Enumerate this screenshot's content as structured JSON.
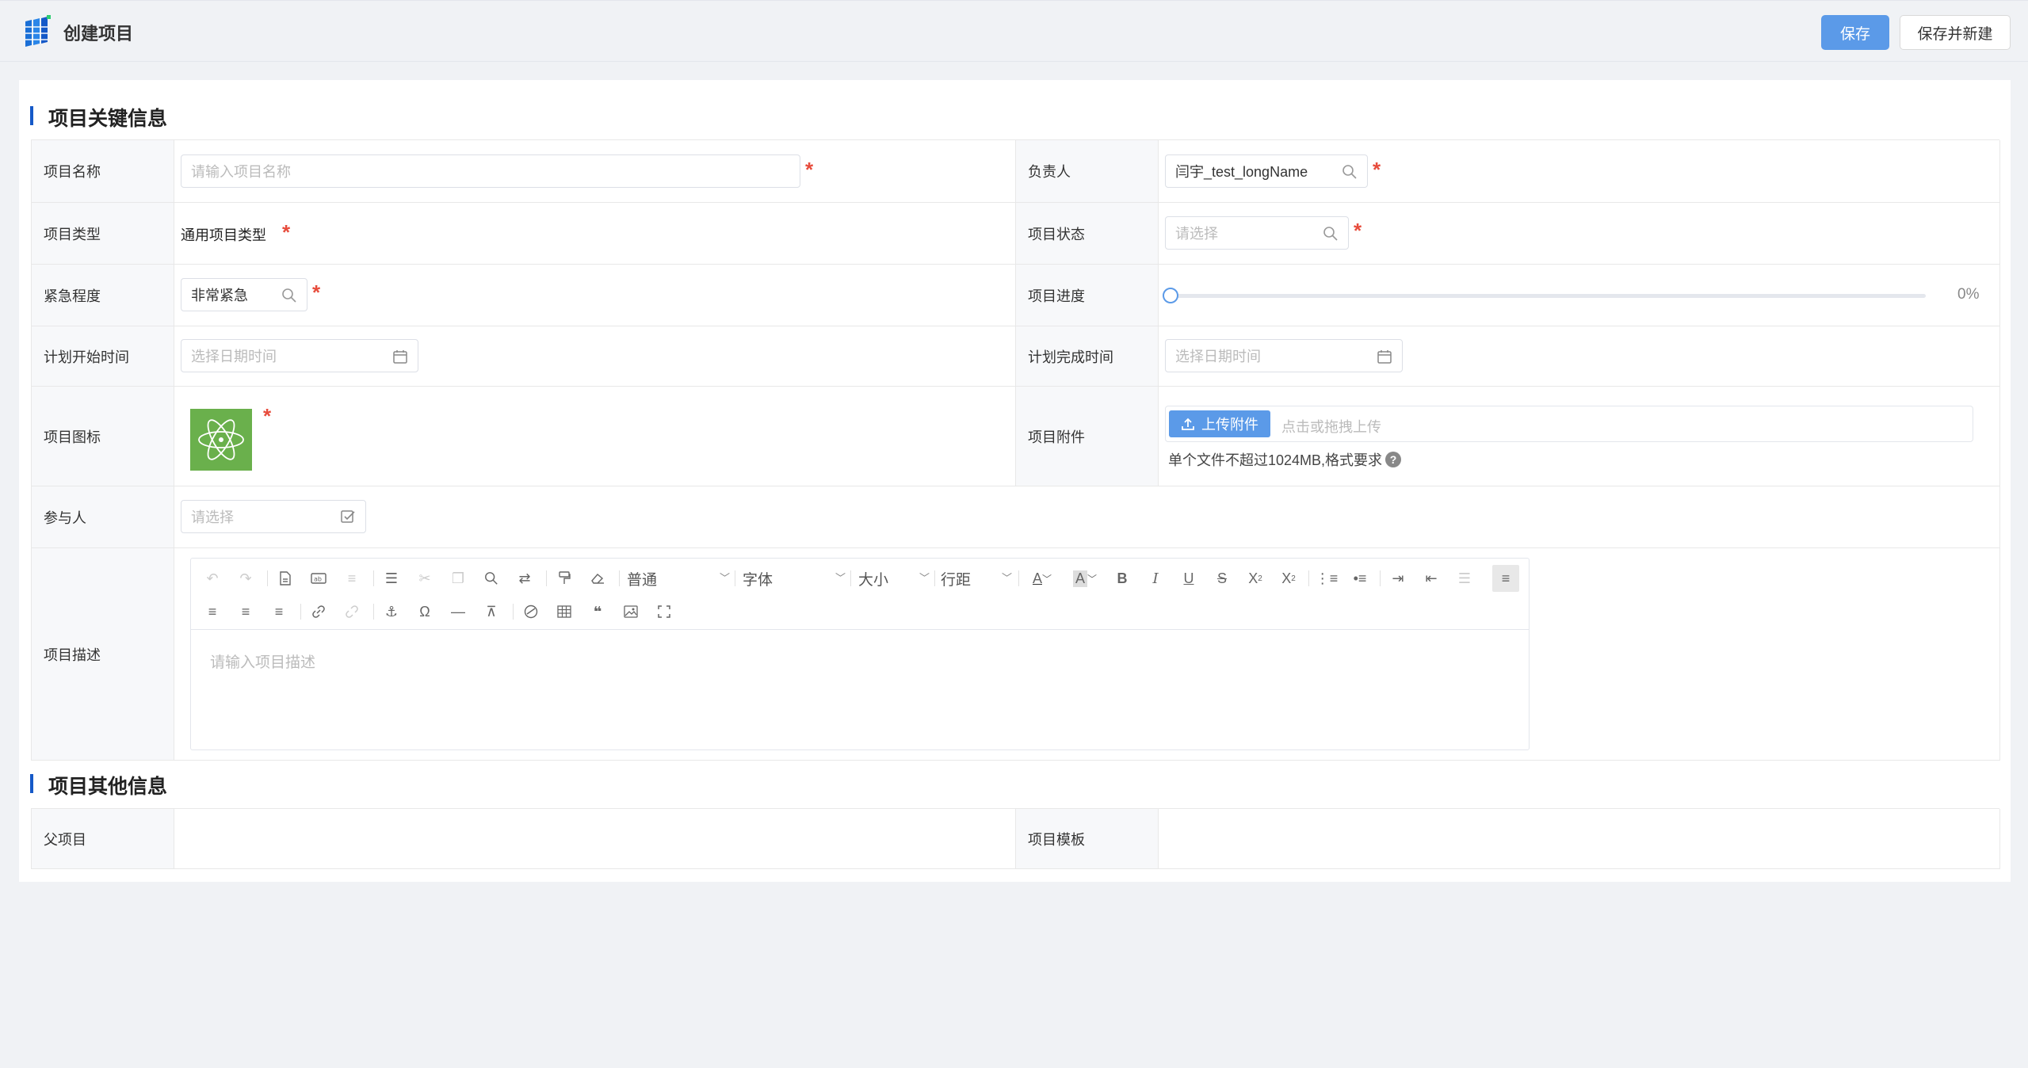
{
  "header": {
    "title": "创建项目",
    "save_label": "保存",
    "save_new_label": "保存并新建"
  },
  "section_key": {
    "title": "项目关键信息"
  },
  "section_other": {
    "title": "项目其他信息"
  },
  "fields": {
    "name": {
      "label": "项目名称",
      "placeholder": "请输入项目名称"
    },
    "owner": {
      "label": "负责人",
      "value": "闫宇_test_longName"
    },
    "type": {
      "label": "项目类型",
      "value": "通用项目类型"
    },
    "status": {
      "label": "项目状态",
      "placeholder": "请选择"
    },
    "urgency": {
      "label": "紧急程度",
      "value": "非常紧急"
    },
    "progress": {
      "label": "项目进度",
      "value": 0,
      "display": "0%"
    },
    "plan_start": {
      "label": "计划开始时间",
      "placeholder": "选择日期时间"
    },
    "plan_end": {
      "label": "计划完成时间",
      "placeholder": "选择日期时间"
    },
    "icon": {
      "label": "项目图标",
      "icon_name": "atom-icon",
      "bg_color": "#6ab04c"
    },
    "attachment": {
      "label": "项目附件",
      "button_label": "上传附件",
      "placeholder": "点击或拖拽上传",
      "hint": "单个文件不超过1024MB,格式要求"
    },
    "participants": {
      "label": "参与人",
      "placeholder": "请选择"
    },
    "description": {
      "label": "项目描述",
      "placeholder": "请输入项目描述"
    },
    "parent": {
      "label": "父项目"
    },
    "template": {
      "label": "项目模板"
    }
  },
  "editor_toolbar": {
    "paragraph_select": "普通",
    "font_select": "字体",
    "size_select": "大小",
    "line_height_select": "行距"
  },
  "colors": {
    "primary": "#5b9ae8",
    "required": "#e74c3c",
    "section_bar": "#1559c8"
  }
}
